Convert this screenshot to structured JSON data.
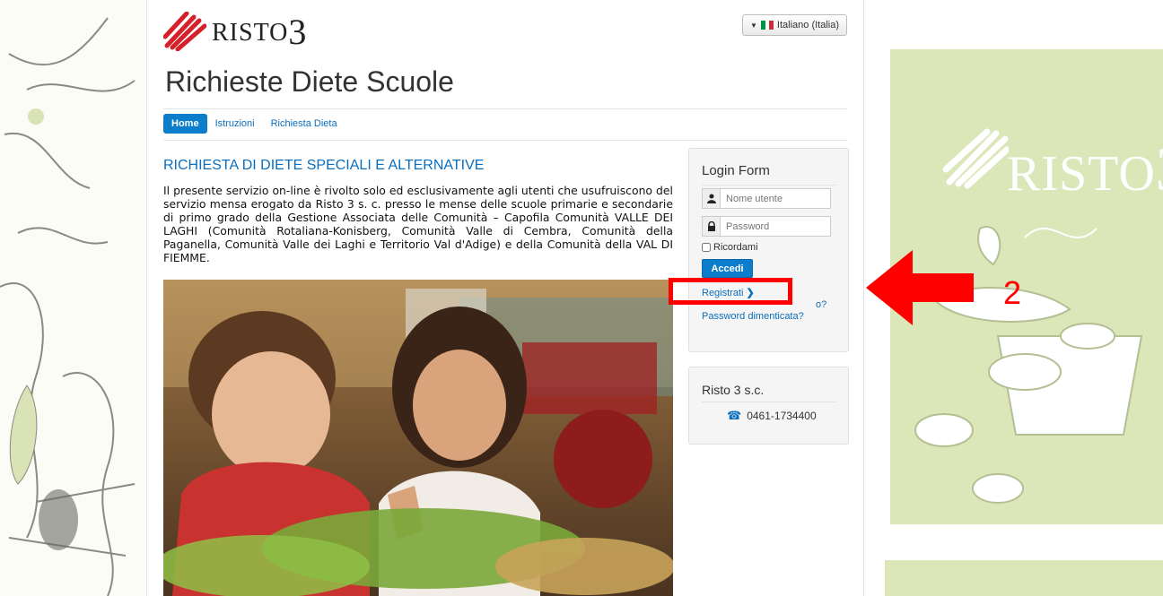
{
  "brand": {
    "logo_text": "RISTO",
    "logo_number": "3"
  },
  "header": {
    "page_title": "Richieste Diete Scuole",
    "language_selector": "Italiano (Italia)"
  },
  "nav": {
    "items": [
      "Home",
      "Istruzioni",
      "Richiesta Dieta"
    ],
    "active": "Home"
  },
  "main": {
    "section_title": "RICHIESTA DI DIETE SPECIALI E ALTERNATIVE",
    "intro": "Il presente servizio on-line è rivolto solo ed esclusivamente agli utenti che usufruiscono del servizio mensa erogato da Risto 3 s. c. presso le mense delle scuole primarie e secondarie di primo grado della Gestione Associata delle Comunità – Capofila Comunità VALLE DEI LAGHI (Comunità Rotaliana-Konisberg, Comunità Valle di Cembra, Comunità della Paganella, Comunità Valle dei Laghi e Territorio Val d'Adige) e della Comunità della VAL DI FIEMME."
  },
  "login": {
    "title": "Login Form",
    "username_placeholder": "Nome utente",
    "password_placeholder": "Password",
    "remember_label": "Ricordami",
    "submit_label": "Accedi",
    "register_link": "Registrati",
    "forgot_username_tail": "o?",
    "forgot_password_link": "Password dimenticata?"
  },
  "contact": {
    "title": "Risto 3 s.c.",
    "phone": "0461-1734400"
  },
  "annotation": {
    "step_number": "2",
    "color": "#ff0000"
  },
  "colors": {
    "primary": "#0b7dcb",
    "link": "#0a6ebd",
    "decor_green": "#dbe7b9"
  }
}
